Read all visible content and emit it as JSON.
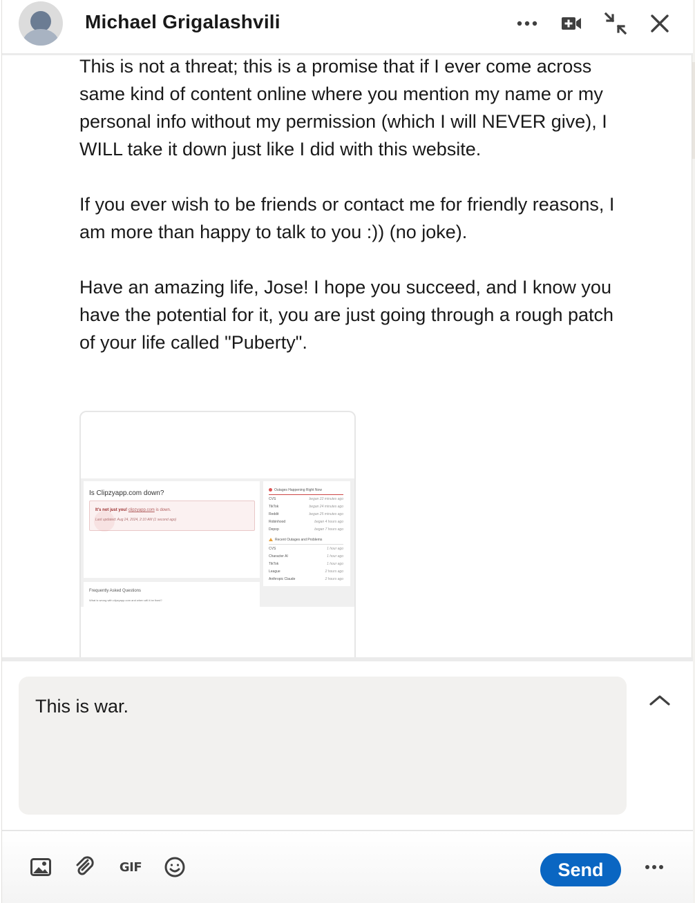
{
  "header": {
    "contact_name": "Michael Grigalashvili"
  },
  "message": {
    "paragraphs": [
      "This is not a threat; this is a promise that if I ever come across same kind of content online where you mention my name or my personal info without my permission (which I will NEVER give), I WILL take it down just like I did with this website.",
      "If you ever wish to be friends or contact me for friendly reasons, I am more than happy to talk to you :)) (no joke).",
      "Have an amazing life, Jose! I hope you succeed, and I know you have the potential for it, you are just going through a rough patch of your life called \"Puberty\"."
    ]
  },
  "attachment": {
    "heading": "Is Clipzyapp.com down?",
    "status_prefix": "It's not just you!",
    "status_link": "clipzyapp.com",
    "status_suffix": "is down.",
    "last_updated": "Last updated: Aug 24, 2024, 2:10 AM (1 second ago)",
    "outages_title": "Outages Happening Right Now",
    "outages": [
      {
        "name": "CVS",
        "time": "began 22 minutes ago"
      },
      {
        "name": "TikTok",
        "time": "began 24 minutes ago"
      },
      {
        "name": "Reddit",
        "time": "began 25 minutes ago"
      },
      {
        "name": "Robinhood",
        "time": "began 4 hours ago"
      },
      {
        "name": "Depop",
        "time": "began 7 hours ago"
      }
    ],
    "recent_title": "Recent Outages and Problems",
    "recent": [
      {
        "name": "CVS",
        "time": "1 hour ago"
      },
      {
        "name": "Character AI",
        "time": "1 hour ago"
      },
      {
        "name": "TikTok",
        "time": "1 hour ago"
      },
      {
        "name": "League",
        "time": "2 hours ago"
      },
      {
        "name": "Anthropic Claude",
        "time": "2 hours ago"
      }
    ],
    "faq_title": "Frequently Asked Questions",
    "faq_question": "What is wrong with clipzyapp.com and when will it be fixed?"
  },
  "composer": {
    "draft_text": "This is war."
  },
  "toolbar": {
    "gif_label": "GIF",
    "send_label": "Send"
  },
  "icons": {
    "more": "more-horizontal-icon",
    "video": "video-call-icon",
    "minimize": "minimize-arrows-icon",
    "close": "close-icon",
    "expand": "chevron-up-icon",
    "image": "image-icon",
    "attach": "paperclip-icon",
    "emoji": "emoji-icon"
  },
  "colors": {
    "send_button": "#0a66c2",
    "input_background": "#f2f1ef",
    "text": "#191919"
  }
}
